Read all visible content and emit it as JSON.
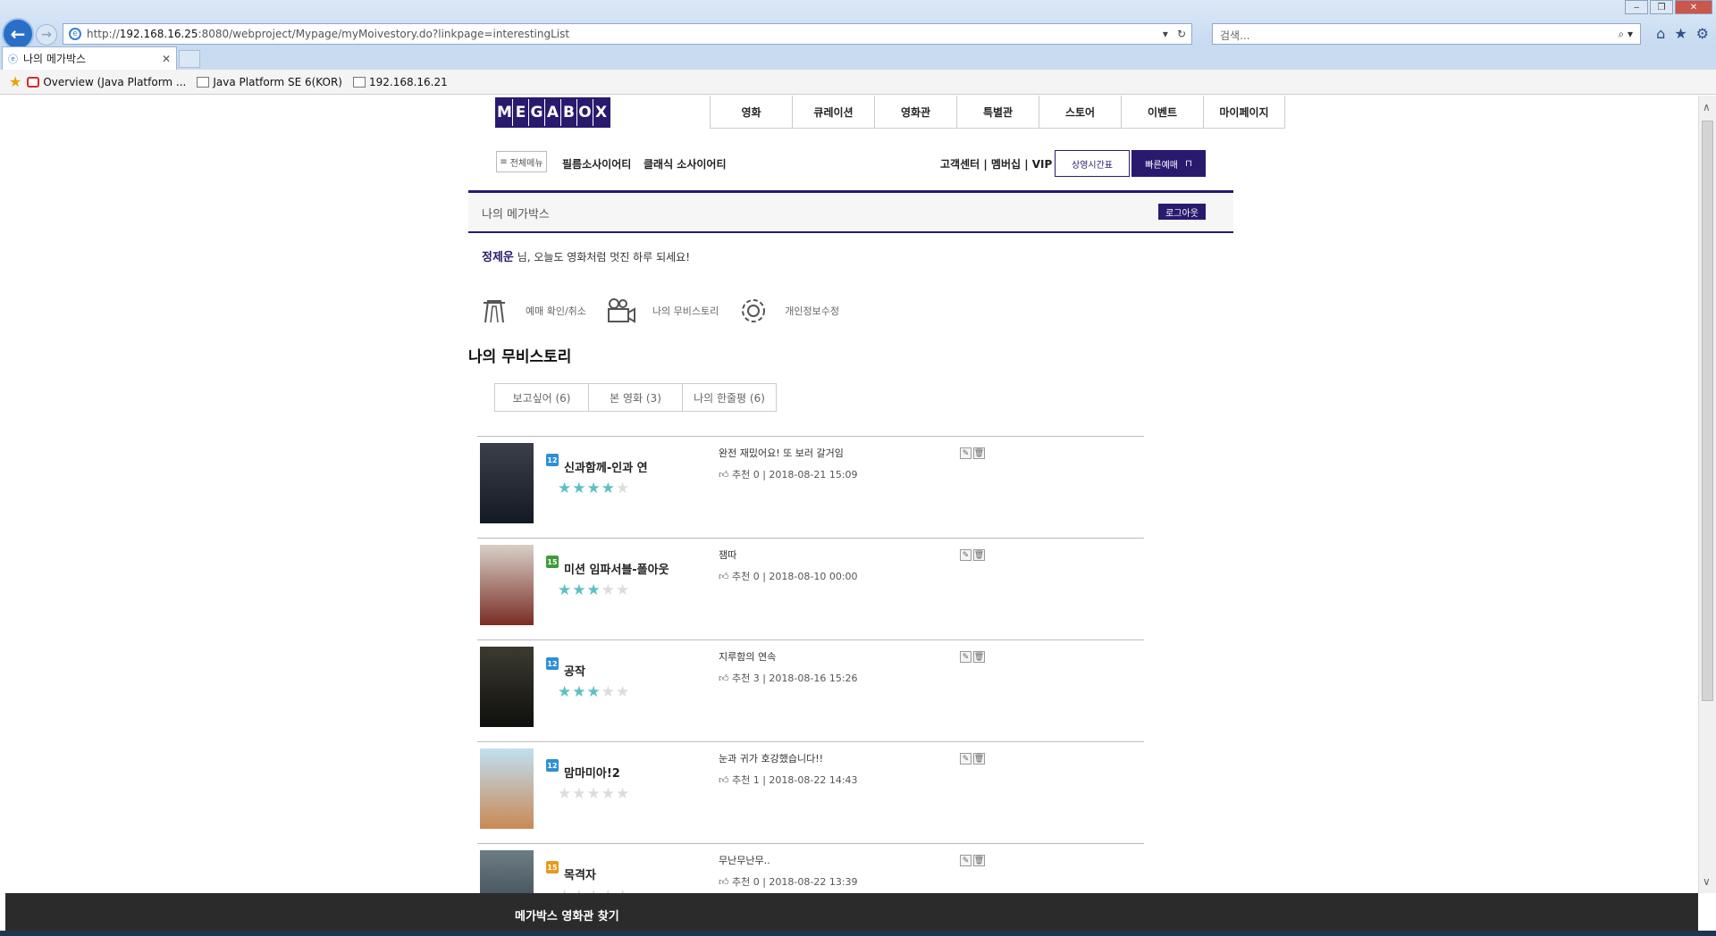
{
  "browser": {
    "url_prefix": "http://",
    "url_host": "192.168.16.25",
    "url_rest": ":8080/webproject/Mypage/myMoivestory.do?linkpage=interestingList",
    "search_placeholder": "검색...",
    "tab_title": "나의 메가박스",
    "favorites": [
      {
        "label": "Overview (Java Platform ...",
        "icon": "oracle-icon"
      },
      {
        "label": "Java Platform SE 6(KOR)",
        "icon": "page-icon"
      },
      {
        "label": "192.168.16.21",
        "icon": "page-icon"
      }
    ]
  },
  "site": {
    "logo_letters": [
      "M",
      "E",
      "G",
      "A",
      "B",
      "O",
      "X"
    ],
    "gnb": [
      "영화",
      "큐레이션",
      "영화관",
      "특별관",
      "스토어",
      "이벤트",
      "마이페이지"
    ],
    "all_menu": "전체메뉴",
    "sub_film": "필름소사이어티",
    "sub_classic": "클래식 소사이어티",
    "util_links": "고객센터 | 멤버십 | VIP",
    "timetable_button": "상영시간표",
    "fastbook_button": "빠른예매"
  },
  "page": {
    "header_title": "나의 메가박스",
    "logout_button": "로그아웃",
    "user_name": "정제운",
    "greeting_suffix": " 님, 오늘도 영화처럼 멋진 하루 되세요!",
    "my_menu": [
      {
        "label": "예매 확인/취소",
        "icon": "ticket-icon"
      },
      {
        "label": "나의 무비스토리",
        "icon": "movie-camera-icon"
      },
      {
        "label": "개인정보수정",
        "icon": "gear-icon"
      }
    ],
    "section_title": "나의 무비스토리",
    "tabs": [
      "보고싶어 (6)",
      "본 영화 (3)",
      "나의 한줄평 (6)"
    ]
  },
  "reviews": [
    {
      "age": "12",
      "age_color": "#2d8fd5",
      "title": "신과함께-인과 연",
      "stars": 4,
      "comment": "완전 재밌어요! 또 보러 갈거임",
      "meta": "추천 0 | 2018-08-21 15:09",
      "poster_colors": [
        "#3a3f4a",
        "#141a24"
      ]
    },
    {
      "age": "15",
      "age_color": "#3f9a3c",
      "title": "미션 임파서블-폴아웃",
      "stars": 3,
      "comment": "잼따",
      "meta": "추천 0 | 2018-08-10 00:00",
      "poster_colors": [
        "#d9d0c8",
        "#7a2d24"
      ]
    },
    {
      "age": "12",
      "age_color": "#2d8fd5",
      "title": "공작",
      "stars": 3,
      "comment": "지루함의 연속",
      "meta": "추천 3 | 2018-08-16 15:26",
      "poster_colors": [
        "#3c3a30",
        "#0f0f0d"
      ]
    },
    {
      "age": "12",
      "age_color": "#2d8fd5",
      "title": "맘마미아!2",
      "stars": 0,
      "comment": "눈과 귀가 호강했습니다!!",
      "meta": "추천 1 | 2018-08-22 14:43",
      "poster_colors": [
        "#bfe0f0",
        "#c98a55"
      ]
    },
    {
      "age": "15",
      "age_color": "#e59b1f",
      "title": "목격자",
      "stars": 0,
      "comment": "무난무난무..",
      "meta": "추천 0 | 2018-08-22 13:39",
      "poster_colors": [
        "#6d7d86",
        "#2d3a40"
      ]
    }
  ],
  "footer": {
    "label": "메가박스 영화관 찾기"
  }
}
